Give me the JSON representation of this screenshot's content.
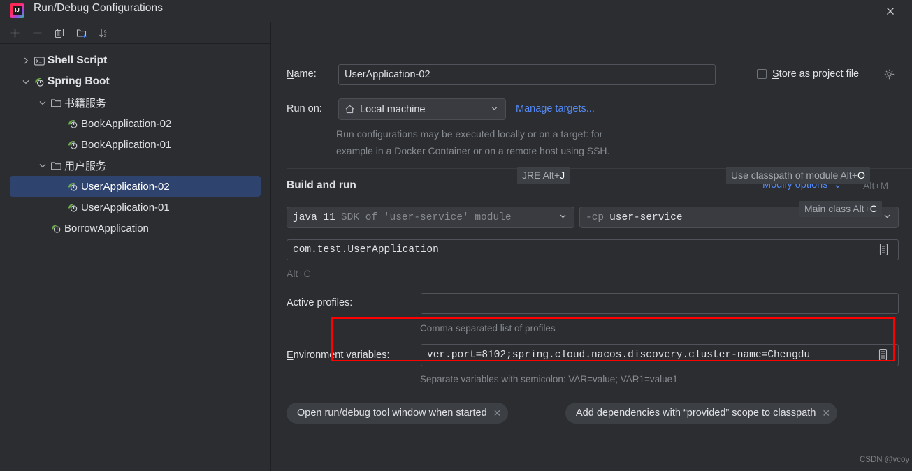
{
  "window": {
    "title": "Run/Debug Configurations",
    "logo_icon": "intellij-idea-logo",
    "close_icon": "close-icon"
  },
  "tree_toolbar": {
    "buttons": [
      {
        "name": "add-configuration-button",
        "icon": "plus-icon"
      },
      {
        "name": "remove-configuration-button",
        "icon": "minus-icon"
      },
      {
        "name": "copy-configuration-button",
        "icon": "copy-icon"
      },
      {
        "name": "new-folder-button",
        "icon": "new-folder-icon"
      },
      {
        "name": "sort-configurations-button",
        "icon": "sort-alphabetically-icon"
      }
    ]
  },
  "tree": {
    "items": [
      {
        "label": "Shell Script",
        "icon": "shell-script-icon",
        "indent": 0,
        "chevron": "collapsed",
        "bold": true,
        "selected": false
      },
      {
        "label": "Spring Boot",
        "icon": "spring-boot-icon",
        "indent": 0,
        "chevron": "expanded",
        "bold": true,
        "selected": false
      },
      {
        "label": "书籍服务",
        "icon": "folder-icon",
        "indent": 1,
        "chevron": "expanded",
        "bold": false,
        "selected": false
      },
      {
        "label": "BookApplication-02",
        "icon": "spring-boot-icon",
        "indent": 2,
        "chevron": "none",
        "bold": false,
        "selected": false
      },
      {
        "label": "BookApplication-01",
        "icon": "spring-boot-icon",
        "indent": 2,
        "chevron": "none",
        "bold": false,
        "selected": false
      },
      {
        "label": "用户服务",
        "icon": "folder-icon",
        "indent": 1,
        "chevron": "expanded",
        "bold": false,
        "selected": false
      },
      {
        "label": "UserApplication-02",
        "icon": "spring-boot-icon",
        "indent": 2,
        "chevron": "none",
        "bold": false,
        "selected": true
      },
      {
        "label": "UserApplication-01",
        "icon": "spring-boot-icon",
        "indent": 2,
        "chevron": "none",
        "bold": false,
        "selected": false
      },
      {
        "label": "BorrowApplication",
        "icon": "spring-boot-icon",
        "indent": 1,
        "chevron": "none",
        "bold": false,
        "selected": false
      }
    ]
  },
  "form": {
    "name_label": "Name:",
    "name_label_mnemonic": "N",
    "name_value": "UserApplication-02",
    "store_as_project_file_label": "Store as project file",
    "store_as_project_file_mnemonic": "S",
    "store_as_project_file_checked": false,
    "store_gear_icon": "gear-icon",
    "run_on_label": "Run on:",
    "run_on_value": "Local machine",
    "run_on_icon": "home-icon",
    "manage_targets_link": "Manage targets...",
    "run_on_description_line1": "Run configurations may be executed locally or on a target: for",
    "run_on_description_line2": "example in a Docker Container or on a remote host using SSH.",
    "build_and_run_title": "Build and run",
    "modify_options_link": "Modify options",
    "modify_options_shortcut": "Alt+M",
    "jre_value_bold": "java 11",
    "jre_value_muted": "SDK of 'user-service' module",
    "classpath_value_muted": "-cp",
    "classpath_value_bold": "user-service",
    "main_class_value": "com.test.UserApplication",
    "main_class_field_icon": "expand-editor-icon",
    "main_class_alt_hint": "Alt+C",
    "active_profiles_label": "Active profiles:",
    "active_profiles_value": "",
    "active_profiles_hint": "Comma separated list of profiles",
    "environment_variables_label": "Environment variables:",
    "environment_variables_label_mnemonic": "E",
    "environment_variables_value": "ver.port=8102;spring.cloud.nacos.discovery.cluster-name=Chengdu",
    "environment_variables_field_icon": "expand-editor-icon",
    "environment_variables_hint": "Separate variables with semicolon: VAR=value; VAR1=value1",
    "tooltips": [
      {
        "name": "jre-shortcut-tooltip",
        "text": "JRE Alt+",
        "key": "J"
      },
      {
        "name": "use-classpath-of-module-shortcut-tooltip",
        "text": "Use classpath of module Alt+",
        "key": "O"
      },
      {
        "name": "main-class-shortcut-tooltip",
        "text": "Main class Alt+",
        "key": "C"
      }
    ],
    "chips": [
      {
        "label": "Open run/debug tool window when started",
        "close_icon": "close-icon"
      },
      {
        "label": "Add dependencies with “provided” scope to classpath",
        "close_icon": "close-icon"
      }
    ]
  },
  "watermark": "CSDN @vcoy",
  "colors": {
    "background": "#2b2d30",
    "selection": "#2e436e",
    "link": "#548af7",
    "highlight_box": "#ff0000",
    "spring_green": "#6cac4a",
    "muted_text": "#868a91"
  }
}
